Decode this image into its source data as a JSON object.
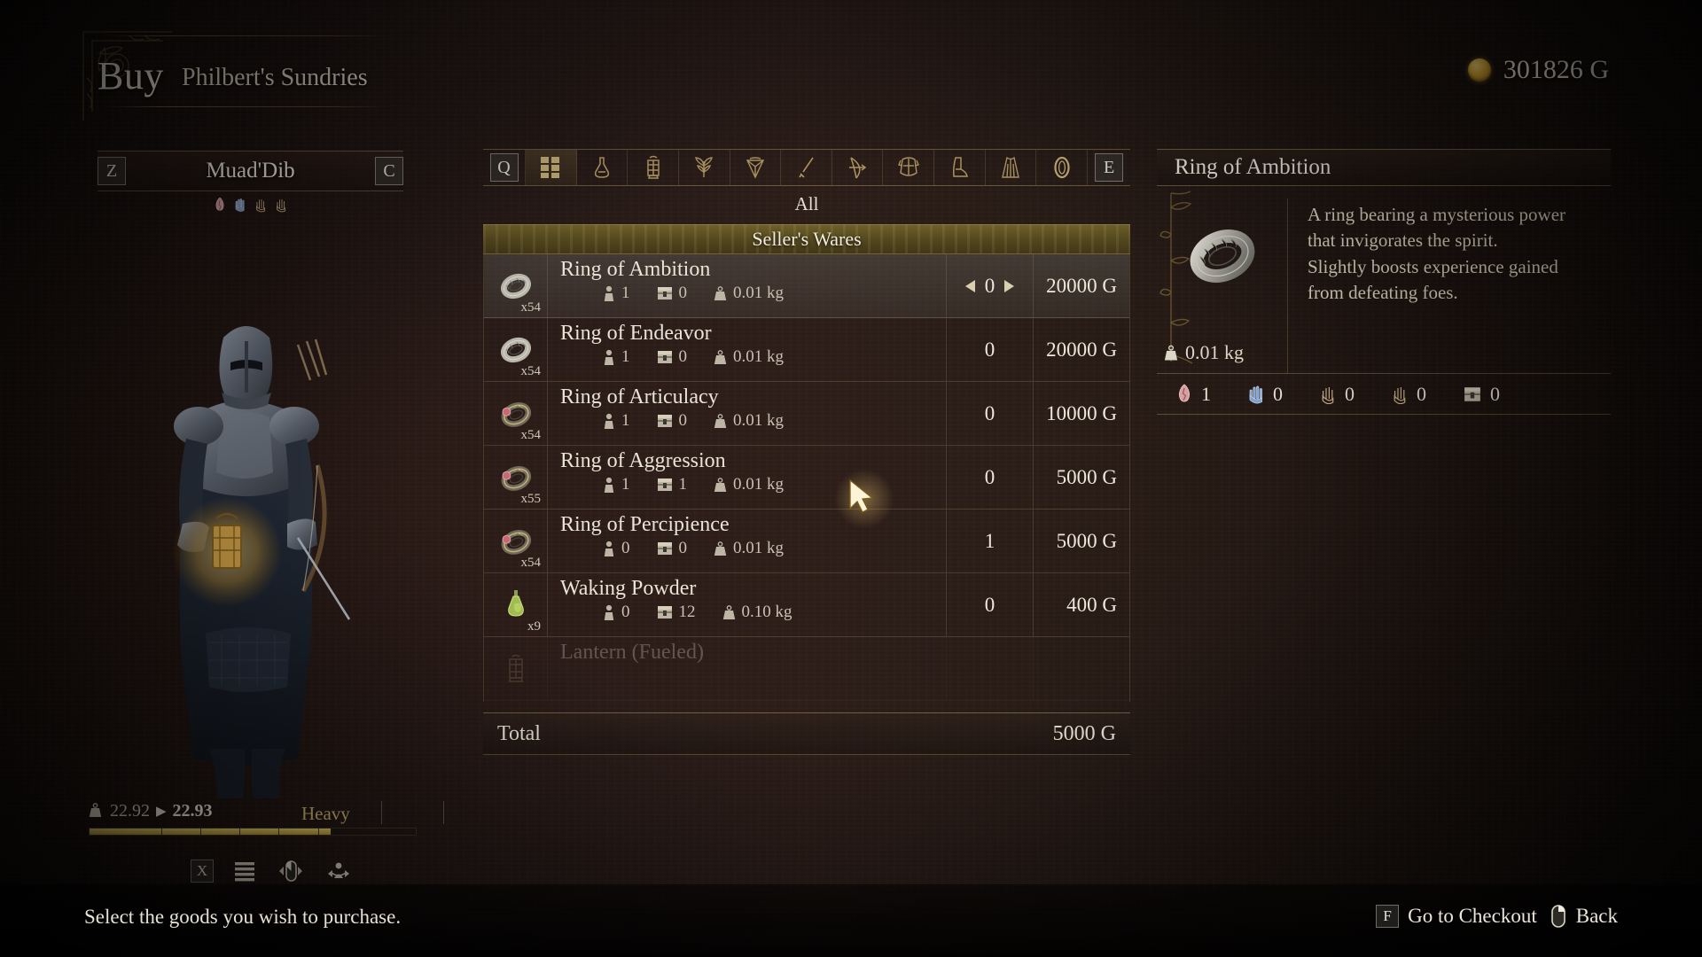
{
  "header": {
    "title": "Buy",
    "shop_name": "Philbert's Sundries",
    "gold": "301826 G",
    "coin_icon": "gold-coin-icon"
  },
  "character": {
    "prev_key": "Z",
    "next_key": "C",
    "name": "Muad'Dib",
    "status_icons": [
      "health-vial-icon",
      "blue-hand-icon",
      "tan-hand-icon",
      "tan-hand-icon"
    ],
    "weight": {
      "icon": "weight-icon",
      "current": "22.92",
      "arrow": "▶",
      "projected": "22.93",
      "status": "Heavy",
      "fill_percent": 74
    },
    "bottom_controls": {
      "x_key": "X",
      "list_icon": "list-icon",
      "mouse_icon": "mouse-rotate-icon",
      "turn_icon": "turn-character-icon"
    }
  },
  "tabs": {
    "prev_key": "Q",
    "next_key": "E",
    "selected_label": "All",
    "items": [
      {
        "name": "tab-all",
        "icon": "grid-icon",
        "selected": true
      },
      {
        "name": "tab-consumables",
        "icon": "flask-icon",
        "selected": false
      },
      {
        "name": "tab-tools",
        "icon": "lantern-icon",
        "selected": false
      },
      {
        "name": "tab-materials",
        "icon": "plant-icon",
        "selected": false
      },
      {
        "name": "tab-ore",
        "icon": "ore-icon",
        "selected": false
      },
      {
        "name": "tab-weapons",
        "icon": "sword-icon",
        "selected": false
      },
      {
        "name": "tab-bows",
        "icon": "bow-icon",
        "selected": false
      },
      {
        "name": "tab-body-armor",
        "icon": "chestplate-icon",
        "selected": false
      },
      {
        "name": "tab-legwear",
        "icon": "boot-icon",
        "selected": false
      },
      {
        "name": "tab-cloaks",
        "icon": "cloak-icon",
        "selected": false
      },
      {
        "name": "tab-rings",
        "icon": "ring-icon",
        "selected": false
      }
    ]
  },
  "list": {
    "header": "Seller's Wares",
    "stat_icons": {
      "inventory": "person-icon",
      "storage": "storage-chest-icon",
      "weight": "weight-icon"
    },
    "rows": [
      {
        "icon": "silver-ring-icon",
        "stock": "x54",
        "name": "Ring of Ambition",
        "inventory": "1",
        "storage": "0",
        "weight": "0.01 kg",
        "qty": "0",
        "price": "20000 G",
        "selected": true,
        "faded": false
      },
      {
        "icon": "silver-ring-icon",
        "stock": "x54",
        "name": "Ring of Endeavor",
        "inventory": "1",
        "storage": "0",
        "weight": "0.01 kg",
        "qty": "0",
        "price": "20000 G",
        "selected": false,
        "faded": false
      },
      {
        "icon": "ruby-ring-icon",
        "stock": "x54",
        "name": "Ring of Articulacy",
        "inventory": "1",
        "storage": "0",
        "weight": "0.01 kg",
        "qty": "0",
        "price": "10000 G",
        "selected": false,
        "faded": false
      },
      {
        "icon": "ruby-ring-icon",
        "stock": "x55",
        "name": "Ring of Aggression",
        "inventory": "1",
        "storage": "1",
        "weight": "0.01 kg",
        "qty": "0",
        "price": "5000 G",
        "selected": false,
        "faded": false
      },
      {
        "icon": "ruby-ring-icon",
        "stock": "x54",
        "name": "Ring of Percipience",
        "inventory": "0",
        "storage": "0",
        "weight": "0.01 kg",
        "qty": "1",
        "price": "5000 G",
        "selected": false,
        "faded": false
      },
      {
        "icon": "green-flask-icon",
        "stock": "x9",
        "name": "Waking Powder",
        "inventory": "0",
        "storage": "12",
        "weight": "0.10 kg",
        "qty": "0",
        "price": "400 G",
        "selected": false,
        "faded": false
      },
      {
        "icon": "lantern-icon",
        "stock": "",
        "name": "Lantern (Fueled)",
        "inventory": "",
        "storage": "",
        "weight": "",
        "qty": "",
        "price": "",
        "selected": false,
        "faded": true
      }
    ],
    "total_label": "Total",
    "total_value": "5000 G"
  },
  "detail": {
    "title": "Ring of Ambition",
    "image": "silver-ring-icon",
    "weight_icon": "weight-icon",
    "weight": "0.01 kg",
    "description": "A ring bearing a mysterious power that invigorates the spirit.\nSlightly boosts experience gained from defeating foes.",
    "stats": [
      {
        "icon": "health-vial-icon",
        "value": "1"
      },
      {
        "icon": "blue-hand-icon",
        "value": "0"
      },
      {
        "icon": "tan-hand-icon",
        "value": "0"
      },
      {
        "icon": "tan-hand-icon",
        "value": "0"
      },
      {
        "icon": "storage-chest-icon",
        "value": "0"
      }
    ]
  },
  "footer": {
    "hint": "Select the goods you wish to purchase.",
    "checkout_key": "F",
    "checkout_label": "Go to Checkout",
    "back_icon": "mouse-right-button-icon",
    "back_label": "Back"
  },
  "colors": {
    "accent_gold": "#b99a32",
    "border_gold": "#ac9260",
    "text_primary": "#eae4d6",
    "status_heavy": "#cdb96f"
  }
}
